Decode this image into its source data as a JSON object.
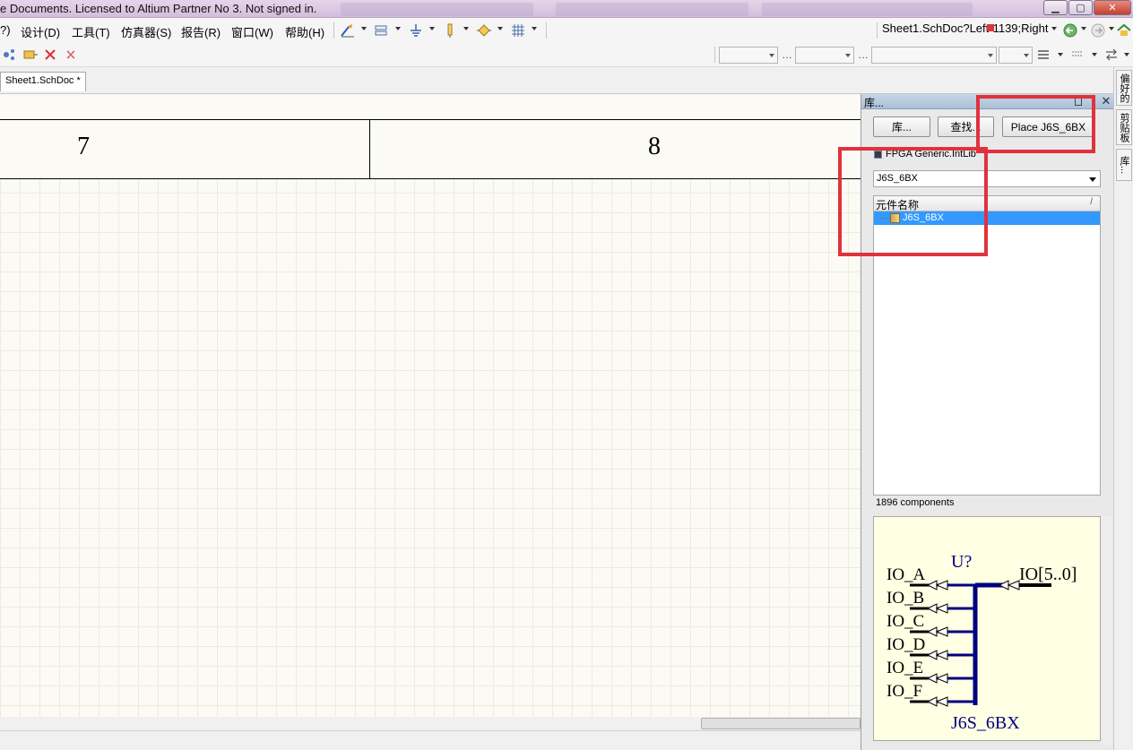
{
  "window": {
    "title": "e Documents. Licensed to Altium Partner No 3. Not signed in.",
    "min_label": "▁",
    "max_label": "▢",
    "close_label": "✕"
  },
  "menu": {
    "items": [
      "?)",
      "设计(D)",
      "工具(T)",
      "仿真器(S)",
      "报告(R)",
      "窗口(W)",
      "帮助(H)"
    ],
    "sheet_location": "Sheet1.SchDoc?Left-1139;Right"
  },
  "tabs": {
    "doc_tab": "Sheet1.SchDoc *"
  },
  "canvas": {
    "zone_labels": [
      "7",
      "8"
    ]
  },
  "panel": {
    "title": "库...",
    "buttons": {
      "libraries": "库...",
      "search": "查找...",
      "place": "Place J6S_6BX"
    },
    "library_name": "FPGA Generic.IntLib",
    "filter_value": "J6S_6BX",
    "list_header": "元件名称",
    "sort_indicator": "/",
    "components": [
      {
        "name": "J6S_6BX",
        "selected": true
      }
    ],
    "component_count": "1896 components",
    "preview": {
      "designator": "U?",
      "comment": "J6S_6BX",
      "bus_pin": "IO[5..0]",
      "pins": [
        "IO_A",
        "IO_B",
        "IO_C",
        "IO_D",
        "IO_E",
        "IO_F"
      ]
    }
  },
  "side_tabs": [
    "偏好的",
    "剪贴板",
    "库..."
  ],
  "colors": {
    "selection": "#3399ff",
    "annotation_red": "#e0323c",
    "sheet_bg": "#fbfaf4",
    "preview_bg": "#ffffe4",
    "preview_wire": "#000080",
    "preview_text": "#000080"
  }
}
